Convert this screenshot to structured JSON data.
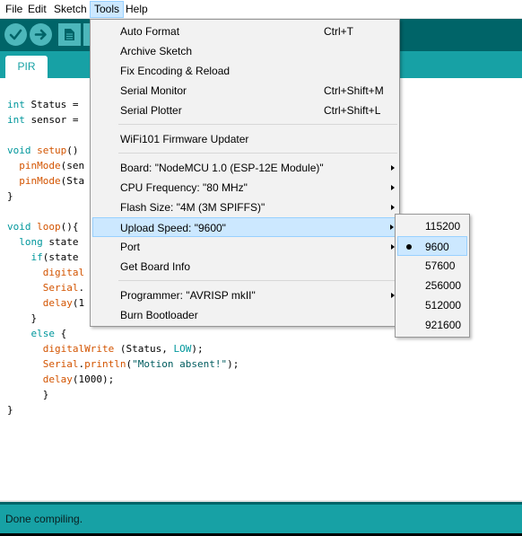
{
  "menubar": {
    "items": [
      "File",
      "Edit",
      "Sketch",
      "Tools",
      "Help"
    ],
    "active": "Tools"
  },
  "toolbar": {
    "verify_icon": "checkmark-icon",
    "upload_icon": "arrow-right-icon",
    "new_icon": "new-file-icon",
    "open_icon": "open-icon"
  },
  "tabs": [
    {
      "label": "PIR"
    }
  ],
  "code": {
    "lines": [
      "int Status = ",
      "int sensor = ",
      "",
      "void setup() ",
      "  pinMode(sen",
      "  pinMode(Sta",
      "}",
      "",
      "void loop(){",
      "  long state ",
      "    if(state ",
      "      digital",
      "      Serial.",
      "      delay(1",
      "    }",
      "    else {",
      "      digitalWrite (Status, LOW);",
      "      Serial.println(\"Motion absent!\");",
      "      delay(1000);",
      "      }",
      "}"
    ]
  },
  "status": {
    "text": "Done compiling."
  },
  "tools_menu": {
    "items": [
      {
        "label": "Auto Format",
        "shortcut": "Ctrl+T"
      },
      {
        "label": "Archive Sketch",
        "shortcut": ""
      },
      {
        "label": "Fix Encoding & Reload",
        "shortcut": ""
      },
      {
        "label": "Serial Monitor",
        "shortcut": "Ctrl+Shift+M"
      },
      {
        "label": "Serial Plotter",
        "shortcut": "Ctrl+Shift+L"
      },
      {
        "label": "WiFi101 Firmware Updater",
        "shortcut": ""
      },
      {
        "label": "Board: \"NodeMCU 1.0 (ESP-12E Module)\"",
        "shortcut": ""
      },
      {
        "label": "CPU Frequency: \"80 MHz\"",
        "shortcut": ""
      },
      {
        "label": "Flash Size: \"4M (3M SPIFFS)\"",
        "shortcut": ""
      },
      {
        "label": "Upload Speed: \"9600\"",
        "shortcut": ""
      },
      {
        "label": "Port",
        "shortcut": ""
      },
      {
        "label": "Get Board Info",
        "shortcut": ""
      },
      {
        "label": "Programmer: \"AVRISP mkII\"",
        "shortcut": ""
      },
      {
        "label": "Burn Bootloader",
        "shortcut": ""
      }
    ],
    "highlighted": "Upload Speed: \"9600\""
  },
  "speed_menu": {
    "options": [
      "115200",
      "9600",
      "57600",
      "256000",
      "512000",
      "921600"
    ],
    "selected": "9600"
  },
  "colors": {
    "toolbar": "#006468",
    "tabstrip": "#17a1a5",
    "button": "#4db7bb",
    "highlight": "#cce8ff"
  }
}
